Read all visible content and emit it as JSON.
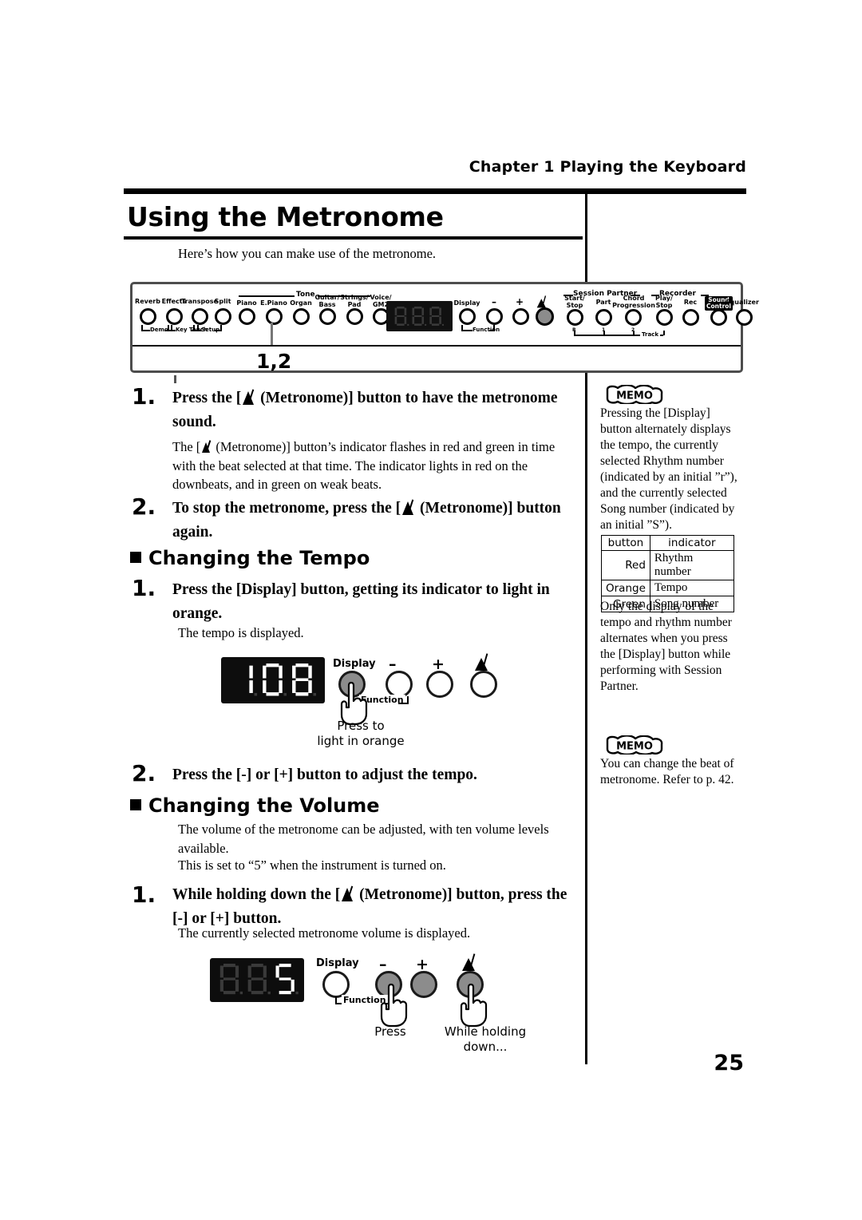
{
  "header": {
    "chapter": "Chapter 1  Playing the Keyboard"
  },
  "title": "Using the Metronome",
  "intro": "Here’s how you can make use of the metronome.",
  "panel": {
    "callout": "1,2",
    "left_buttons": [
      {
        "label": "Reverb"
      },
      {
        "label": "Effects"
      },
      {
        "label": "Transpose"
      },
      {
        "label": "Split"
      }
    ],
    "left_sub": [
      {
        "label": "Demo"
      },
      {
        "label": "Key Touch"
      },
      {
        "label": "Setup"
      }
    ],
    "tone_group": "Tone",
    "tone_buttons": [
      {
        "label": "Piano"
      },
      {
        "label": "E.Piano"
      },
      {
        "label": "Organ"
      },
      {
        "label": "Guitar/\nBass"
      },
      {
        "label": "Strings/\nPad"
      },
      {
        "label": "Voice/\nGM2"
      }
    ],
    "display_label": "Display",
    "minus": "–",
    "plus": "+",
    "function_label": "Function",
    "metronome_icon": "metronome-icon",
    "session_group": "Session Partner",
    "session_buttons": [
      {
        "label": "Start/\nStop"
      },
      {
        "label": "Part"
      },
      {
        "label": "Chord\nProgression"
      }
    ],
    "recorder_group": "Recorder",
    "recorder_buttons": [
      {
        "label": "Play/\nStop"
      },
      {
        "label": "Rec"
      }
    ],
    "track_label": "Track",
    "track_nums": [
      "R",
      "1",
      "2"
    ],
    "sound_control": "Sound\nControl",
    "equalizer": "Equalizer",
    "led_digits": "888"
  },
  "steps": {
    "s1_num": "1.",
    "s1_a": "Press the [",
    "s1_b": "(Metronome)] button to have the metronome",
    "s1_c": "sound.",
    "s1_body_a": "The [",
    "s1_body_b": "(Metronome)] button’s indicator flashes in red and green in time",
    "s1_body_c": "with the beat selected at that time. The indicator lights in red on the",
    "s1_body_d": "downbeats, and in green on weak beats.",
    "s2_num": "2.",
    "s2_a": "To stop the metronome, press the [",
    "s2_b": "(Metronome)] button",
    "s2_c": "again."
  },
  "tempo_section": {
    "heading": "Changing the Tempo",
    "s1_num": "1.",
    "s1_a": "Press the [Display] button, getting its indicator to light in",
    "s1_b": "orange.",
    "s1_body": "The tempo is displayed.",
    "s2_num": "2.",
    "s2_a": "Press the [-] or [+] button to adjust the tempo."
  },
  "tempo_figure": {
    "value": "108",
    "display_label": "Display",
    "minus": "–",
    "plus": "+",
    "function_label": "Function",
    "metronome_icon": "metronome-icon",
    "caption_line1": "Press to",
    "caption_line2": "light in orange"
  },
  "volume_section": {
    "heading": "Changing the Volume",
    "body_a": "The volume of the metronome can be adjusted, with ten volume levels",
    "body_b": "available.",
    "body_c": "This is set to “5” when the instrument is turned on.",
    "s1_num": "1.",
    "s1_a": "While holding down the [",
    "s1_b": "(Metronome)] button, press the",
    "s1_c": "[-] or [+] button.",
    "s1_body": "The currently selected metronome volume is displayed."
  },
  "volume_figure": {
    "value": "5",
    "display_label": "Display",
    "minus": "–",
    "plus": "+",
    "function_label": "Function",
    "metronome_icon": "metronome-icon",
    "caption_press": "Press",
    "caption_hold": "While holding down..."
  },
  "sidebar": {
    "memo1_badge": "MEMO",
    "memo1_lines": [
      "Pressing the [Display]",
      "button alternately displays",
      "the tempo, the currently",
      "selected Rhythm number",
      "(indicated by an initial ”r”),",
      "and the currently selected",
      "Song number (indicated by",
      "an initial ”S”)."
    ],
    "table": {
      "headers": [
        "button",
        "indicator"
      ],
      "rows": [
        [
          "Red",
          "Rhythm number"
        ],
        [
          "Orange",
          "Tempo"
        ],
        [
          "Green",
          "Song number"
        ]
      ]
    },
    "note_lines": [
      "Only the display of the",
      "tempo and rhythm number",
      "alternates when you press",
      "the [Display] button while",
      "performing with Session",
      "Partner."
    ],
    "memo2_badge": "MEMO",
    "memo2_lines": [
      "You can change the beat of",
      "metronome. Refer to p. 42."
    ]
  },
  "page_number": "25"
}
